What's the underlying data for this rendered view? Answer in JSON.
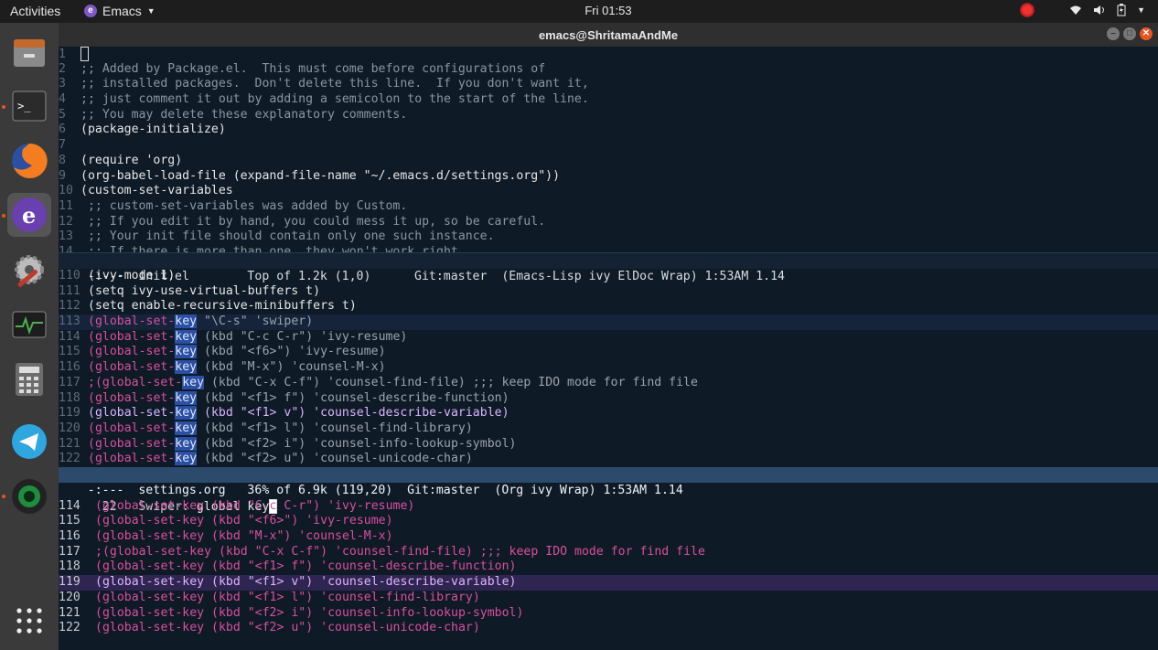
{
  "topbar": {
    "activities": "Activities",
    "app_name": "Emacs",
    "clock": "Fri 01:53",
    "icons": [
      "record-icon",
      "wifi-icon",
      "volume-icon",
      "battery-icon",
      "menu-chevron-icon"
    ]
  },
  "dock": {
    "items": [
      "files",
      "terminal",
      "firefox",
      "emacs",
      "settings",
      "system-monitor",
      "calculator",
      "telegram",
      "camera",
      "show-apps"
    ]
  },
  "window": {
    "title": "emacs@ShritamaAndMe"
  },
  "pane1": {
    "lines": [
      {
        "n": "1",
        "t": ""
      },
      {
        "n": "2",
        "t": ";; Added by Package.el.  This must come before configurations of"
      },
      {
        "n": "3",
        "t": ";; installed packages.  Don't delete this line.  If you don't want it,"
      },
      {
        "n": "4",
        "t": ";; just comment it out by adding a semicolon to the start of the line."
      },
      {
        "n": "5",
        "t": ";; You may delete these explanatory comments."
      },
      {
        "n": "6",
        "t": "(package-initialize)"
      },
      {
        "n": "7",
        "t": ""
      },
      {
        "n": "8",
        "t": "(require 'org)"
      },
      {
        "n": "9",
        "t": "(org-babel-load-file (expand-file-name \"~/.emacs.d/settings.org\"))"
      },
      {
        "n": "10",
        "t": "(custom-set-variables"
      },
      {
        "n": "11",
        "t": " ;; custom-set-variables was added by Custom."
      },
      {
        "n": "12",
        "t": " ;; If you edit it by hand, you could mess it up, so be careful."
      },
      {
        "n": "13",
        "t": " ;; Your init file should contain only one such instance."
      },
      {
        "n": "14",
        "t": " ;; If there is more than one, they won't work right."
      }
    ],
    "modeline": "-:---  init.el        Top of 1.2k (1,0)      Git:master  (Emacs-Lisp ivy ElDoc Wrap) 1:53AM 1.14",
    "modeline_file": "init.el"
  },
  "pane2": {
    "lines": [
      {
        "n": "110",
        "pre": "(ivy-mode 1)",
        "gk": "",
        "post": ""
      },
      {
        "n": "111",
        "pre": "(setq ivy-use-virtual-buffers t)",
        "gk": "",
        "post": ""
      },
      {
        "n": "112",
        "pre": "(setq enable-recursive-minibuffers t)",
        "gk": "",
        "post": ""
      },
      {
        "n": "113",
        "pre": "(global-set-",
        "gk": "key",
        "post": " \"\\C-s\" 'swiper)"
      },
      {
        "n": "114",
        "pre": "(global-set-",
        "gk": "key",
        "post": " (kbd \"C-c C-r\") 'ivy-resume)"
      },
      {
        "n": "115",
        "pre": "(global-set-",
        "gk": "key",
        "post": " (kbd \"<f6>\") 'ivy-resume)"
      },
      {
        "n": "116",
        "pre": "(global-set-",
        "gk": "key",
        "post": " (kbd \"M-x\") 'counsel-M-x)"
      },
      {
        "n": "117",
        "pre": ";(global-set-",
        "gk": "key",
        "post": " (kbd \"C-x C-f\") 'counsel-find-file) ;;; keep IDO mode for find file"
      },
      {
        "n": "118",
        "pre": "(global-set-",
        "gk": "key",
        "post": " (kbd \"<f1> f\") 'counsel-describe-function)"
      },
      {
        "n": "119",
        "pre": "(global-set-",
        "gk": "key",
        "post": " (kbd \"<f1> v\") 'counsel-describe-variable)"
      },
      {
        "n": "120",
        "pre": "(global-set-",
        "gk": "key",
        "post": " (kbd \"<f1> l\") 'counsel-find-library)"
      },
      {
        "n": "121",
        "pre": "(global-set-",
        "gk": "key",
        "post": " (kbd \"<f2> i\") 'counsel-info-lookup-symbol)"
      },
      {
        "n": "122",
        "pre": "(global-set-",
        "gk": "key",
        "post": " (kbd \"<f2> u\") 'counsel-unicode-char)"
      }
    ],
    "modeline": "-:---  settings.org   36% of 6.9k (119,20)  Git:master  (Org ivy Wrap) 1:53AM 1.14"
  },
  "minibuffer": {
    "prompt": "22   Swiper: ",
    "input": "global key",
    "candidates": [
      {
        "n": "114",
        "t": "(global-set-key (kbd \"C-c C-r\") 'ivy-resume)"
      },
      {
        "n": "115",
        "t": "(global-set-key (kbd \"<f6>\") 'ivy-resume)"
      },
      {
        "n": "116",
        "t": "(global-set-key (kbd \"M-x\") 'counsel-M-x)"
      },
      {
        "n": "117",
        "t": ";(global-set-key (kbd \"C-x C-f\") 'counsel-find-file) ;;; keep IDO mode for find file"
      },
      {
        "n": "118",
        "t": "(global-set-key (kbd \"<f1> f\") 'counsel-describe-function)"
      },
      {
        "n": "119",
        "t": "(global-set-key (kbd \"<f1> v\") 'counsel-describe-variable)"
      },
      {
        "n": "120",
        "t": "(global-set-key (kbd \"<f1> l\") 'counsel-find-library)"
      },
      {
        "n": "121",
        "t": "(global-set-key (kbd \"<f2> i\") 'counsel-info-lookup-symbol)"
      },
      {
        "n": "122",
        "t": "(global-set-key (kbd \"<f2> u\") 'counsel-unicode-char)"
      }
    ],
    "selected": "119"
  },
  "colors": {
    "background": "#0e1a26",
    "highlight": "#2a4fa3",
    "global_set_key": "#d94f9f",
    "selected_candidate": "#2e2550"
  }
}
